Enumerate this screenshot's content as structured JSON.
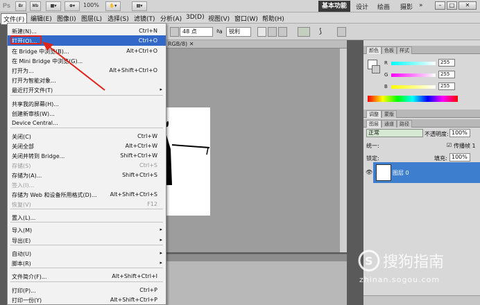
{
  "app": {
    "logo": "Ps",
    "zoom": "100%",
    "mode_buttons": [
      "Br",
      "Mb"
    ]
  },
  "workspaces": [
    "基本功能",
    "设计",
    "绘画",
    "摄影",
    "»"
  ],
  "window_controls": [
    "–",
    "□",
    "✕"
  ],
  "menubar": [
    "文件(F)",
    "编辑(E)",
    "图像(I)",
    "图层(L)",
    "选择(S)",
    "滤镜(T)",
    "分析(A)",
    "3D(D)",
    "视图(V)",
    "窗口(W)",
    "帮助(H)"
  ],
  "options": {
    "font_size": "48 点",
    "aa_prefix": "ªa",
    "antialias": "锐利"
  },
  "document": {
    "tab_label": "RGB/8) ✕"
  },
  "file_menu": {
    "items": [
      {
        "label": "新建(N)...",
        "shortcut": "Ctrl+N"
      },
      {
        "label": "打开(O)...",
        "shortcut": "Ctrl+O"
      },
      {
        "label": "在 Bridge 中浏览(B)...",
        "shortcut": "Alt+Ctrl+O"
      },
      {
        "label": "在 Mini Bridge 中浏览(G)...",
        "shortcut": ""
      },
      {
        "label": "打开为...",
        "shortcut": "Alt+Shift+Ctrl+O"
      },
      {
        "label": "打开为智能对象...",
        "shortcut": ""
      },
      {
        "label": "最近打开文件(T)",
        "shortcut": ""
      },
      {
        "label": "共享我的屏幕(H)...",
        "shortcut": ""
      },
      {
        "label": "创建新审核(W)...",
        "shortcut": ""
      },
      {
        "label": "Device Central...",
        "shortcut": ""
      },
      {
        "label": "关闭(C)",
        "shortcut": "Ctrl+W"
      },
      {
        "label": "关闭全部",
        "shortcut": "Alt+Ctrl+W"
      },
      {
        "label": "关闭并转到 Bridge...",
        "shortcut": "Shift+Ctrl+W"
      },
      {
        "label": "存储(S)",
        "shortcut": "Ctrl+S"
      },
      {
        "label": "存储为(A)...",
        "shortcut": "Shift+Ctrl+S"
      },
      {
        "label": "签入(I)...",
        "shortcut": ""
      },
      {
        "label": "存储为 Web 和设备所用格式(D)...",
        "shortcut": "Alt+Shift+Ctrl+S"
      },
      {
        "label": "恢复(V)",
        "shortcut": "F12"
      },
      {
        "label": "置入(L)...",
        "shortcut": ""
      },
      {
        "label": "导入(M)",
        "shortcut": ""
      },
      {
        "label": "导出(E)",
        "shortcut": ""
      },
      {
        "label": "自动(U)",
        "shortcut": ""
      },
      {
        "label": "脚本(R)",
        "shortcut": ""
      },
      {
        "label": "文件简介(F)...",
        "shortcut": "Alt+Shift+Ctrl+I"
      },
      {
        "label": "打印(P)...",
        "shortcut": "Ctrl+P"
      },
      {
        "label": "打印一份(Y)",
        "shortcut": "Alt+Shift+Ctrl+P"
      }
    ],
    "submenu_arrow": "▸"
  },
  "color_panel": {
    "tabs": [
      "颜色",
      "色板",
      "样式"
    ],
    "channels": [
      {
        "name": "R",
        "value": "255"
      },
      {
        "name": "G",
        "value": "255"
      },
      {
        "name": "B",
        "value": "255"
      }
    ]
  },
  "adjust_tabs": [
    "调整",
    "蒙版"
  ],
  "layers_panel": {
    "tabs": [
      "图层",
      "通道",
      "路径"
    ],
    "blend_mode": "正常",
    "opacity_label": "不透明度:",
    "opacity_value": "100%",
    "unify_label": "统一:",
    "propagate_label": "传播帧 1",
    "lock_label": "锁定:",
    "fill_label": "填充:",
    "fill_value": "100%",
    "layer_name": "图层 0"
  },
  "watermark": {
    "brand": "搜狗指南",
    "url": "zhinan.sogou.com"
  },
  "colors": {
    "highlight": "#3268c8",
    "annotation": "#e0241c",
    "panel": "#d8d8d8"
  }
}
